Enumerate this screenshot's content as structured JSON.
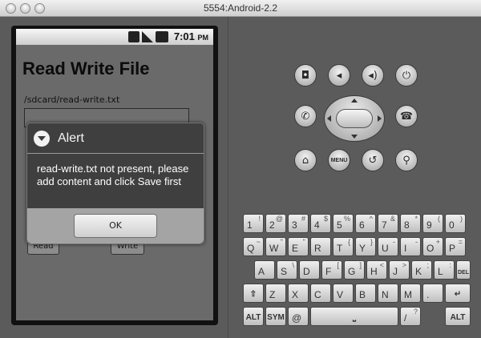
{
  "window": {
    "title": "5554:Android-2.2"
  },
  "statusbar": {
    "time": "7:01",
    "ampm": "PM"
  },
  "app": {
    "title": "Read Write File",
    "path": "/sdcard/read-write.txt",
    "read_label": "Read",
    "write_label": "Write"
  },
  "alert": {
    "title": "Alert",
    "message": "read-write.txt not present, please add content and click Save first",
    "ok_label": "OK"
  },
  "hardware": {
    "menu_label": "MENU"
  },
  "keyboard": {
    "row1": [
      {
        "main": "1",
        "alt": "!"
      },
      {
        "main": "2",
        "alt": "@"
      },
      {
        "main": "3",
        "alt": "#"
      },
      {
        "main": "4",
        "alt": "$"
      },
      {
        "main": "5",
        "alt": "%"
      },
      {
        "main": "6",
        "alt": "^"
      },
      {
        "main": "7",
        "alt": "&"
      },
      {
        "main": "8",
        "alt": "*"
      },
      {
        "main": "9",
        "alt": "("
      },
      {
        "main": "0",
        "alt": ")"
      }
    ],
    "row2": [
      {
        "main": "Q",
        "alt": "~"
      },
      {
        "main": "W",
        "alt": "\""
      },
      {
        "main": "E",
        "alt": "\""
      },
      {
        "main": "R",
        "alt": ""
      },
      {
        "main": "T",
        "alt": "{"
      },
      {
        "main": "Y",
        "alt": "}"
      },
      {
        "main": "U",
        "alt": "-"
      },
      {
        "main": "I",
        "alt": "-"
      },
      {
        "main": "O",
        "alt": "+"
      },
      {
        "main": "P",
        "alt": "="
      }
    ],
    "row3": [
      {
        "main": "A",
        "alt": ""
      },
      {
        "main": "S",
        "alt": "\\"
      },
      {
        "main": "D",
        "alt": ""
      },
      {
        "main": "F",
        "alt": "["
      },
      {
        "main": "G",
        "alt": "]"
      },
      {
        "main": "H",
        "alt": "<"
      },
      {
        "main": "J",
        "alt": ">"
      },
      {
        "main": "K",
        "alt": ";"
      },
      {
        "main": "L",
        "alt": ":"
      }
    ],
    "row4": [
      {
        "main": "Z",
        "alt": ""
      },
      {
        "main": "X",
        "alt": ""
      },
      {
        "main": "C",
        "alt": ""
      },
      {
        "main": "V",
        "alt": ""
      },
      {
        "main": "B",
        "alt": ""
      },
      {
        "main": "N",
        "alt": ""
      },
      {
        "main": "M",
        "alt": ""
      },
      {
        "main": ".",
        "alt": ""
      }
    ],
    "del_label": "DEL",
    "alt_label": "ALT",
    "sym_label": "SYM",
    "at_label": "@",
    "slash_label": "/",
    "question_label": "?"
  }
}
